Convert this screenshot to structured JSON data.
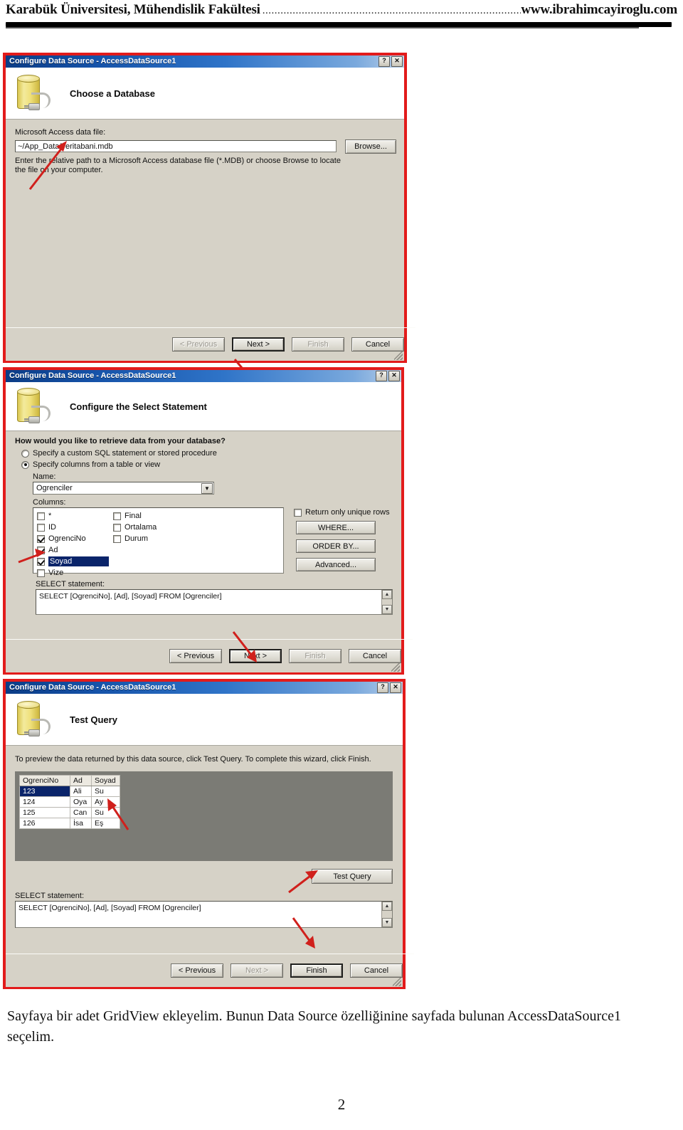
{
  "page_header": {
    "left": "Karabük Üniversitesi, Mühendislik Fakültesi",
    "dots": "......................................................................................................",
    "right": "www.ibrahimcayiroglu.com"
  },
  "dialog1": {
    "title": "Configure Data Source - AccessDataSource1",
    "help_btn": "?",
    "close_btn": "✕",
    "banner_title": "Choose a Database",
    "field_label": "Microsoft Access data file:",
    "field_value": "~/App_Data/veritabani.mdb",
    "browse_label": "Browse...",
    "hint_line1": "Enter the relative path to a Microsoft Access database file (*.MDB) or choose Browse to locate",
    "hint_line2": "the file on your computer.",
    "nav": {
      "previous": "< Previous",
      "next": "Next >",
      "finish": "Finish",
      "cancel": "Cancel"
    }
  },
  "dialog2": {
    "title": "Configure Data Source - AccessDataSource1",
    "help_btn": "?",
    "close_btn": "✕",
    "banner_title": "Configure the Select Statement",
    "question": "How would you like to retrieve data from your database?",
    "radio_custom": "Specify a custom SQL statement or stored procedure",
    "radio_columns": "Specify columns from a table or view",
    "name_label": "Name:",
    "name_value": "Ogrenciler",
    "columns_label": "Columns:",
    "columns_left": [
      {
        "label": "*",
        "checked": false,
        "selected": false
      },
      {
        "label": "ID",
        "checked": false,
        "selected": false
      },
      {
        "label": "OgrenciNo",
        "checked": true,
        "selected": false
      },
      {
        "label": "Ad",
        "checked": true,
        "selected": false
      },
      {
        "label": "Soyad",
        "checked": true,
        "selected": true
      },
      {
        "label": "Vize",
        "checked": false,
        "selected": false
      }
    ],
    "columns_right": [
      {
        "label": "Final",
        "checked": false
      },
      {
        "label": "Ortalama",
        "checked": false
      },
      {
        "label": "Durum",
        "checked": false
      }
    ],
    "unique_rows_label": "Return only unique rows",
    "unique_rows_checked": false,
    "where_label": "WHERE...",
    "orderby_label": "ORDER BY...",
    "advanced_label": "Advanced...",
    "select_label": "SELECT statement:",
    "select_value": "SELECT [OgrenciNo], [Ad], [Soyad] FROM [Ogrenciler]",
    "nav": {
      "previous": "< Previous",
      "next": "Next >",
      "finish": "Finish",
      "cancel": "Cancel"
    }
  },
  "dialog3": {
    "title": "Configure Data Source - AccessDataSource1",
    "help_btn": "?",
    "close_btn": "✕",
    "banner_title": "Test Query",
    "instruction": "To preview the data returned by this data source, click Test Query. To complete this wizard, click Finish.",
    "grid": {
      "headers": [
        "OgrenciNo",
        "Ad",
        "Soyad"
      ],
      "rows": [
        [
          "123",
          "Ali",
          "Su"
        ],
        [
          "124",
          "Oya",
          "Ay"
        ],
        [
          "125",
          "Can",
          "Su"
        ],
        [
          "126",
          "İsa",
          "Eş"
        ]
      ],
      "selected_cell": "123"
    },
    "test_query_label": "Test Query",
    "select_label": "SELECT statement:",
    "select_value": "SELECT [OgrenciNo], [Ad], [Soyad] FROM [Ogrenciler]",
    "nav": {
      "previous": "< Previous",
      "next": "Next >",
      "finish": "Finish",
      "cancel": "Cancel"
    }
  },
  "caption": {
    "line1": "Sayfaya bir adet GridView ekleyelim. Bunun Data Source özelliğinine sayfada bulunan AccessDataSource1",
    "line2": "seçelim."
  },
  "page_number": "2",
  "colors": {
    "annotation": "#d0201c",
    "titlebar": "#1552a8",
    "selection": "#0a246a",
    "dialog_face": "#d6d2c7"
  }
}
